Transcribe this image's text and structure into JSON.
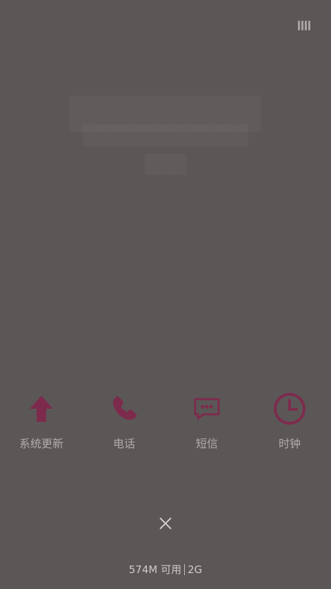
{
  "apps": {
    "items": [
      {
        "label": "系统更新",
        "icon": "upload-arrow-icon"
      },
      {
        "label": "电话",
        "icon": "phone-icon"
      },
      {
        "label": "短信",
        "icon": "message-bubble-icon"
      },
      {
        "label": "时钟",
        "icon": "clock-icon"
      }
    ]
  },
  "controls": {
    "close": {
      "icon": "close-icon"
    },
    "top_right": {
      "icon": "recent-apps-icon"
    }
  },
  "status": {
    "memory_text": "574M 可用",
    "network_text": "2G"
  },
  "colors": {
    "background": "#5b5757",
    "icon_accent": "#7d2b4d",
    "label_text": "#b2acac",
    "status_text": "#cfc9c9",
    "close_icon": "#d2cece",
    "top_icon": "#a9a4a4"
  }
}
